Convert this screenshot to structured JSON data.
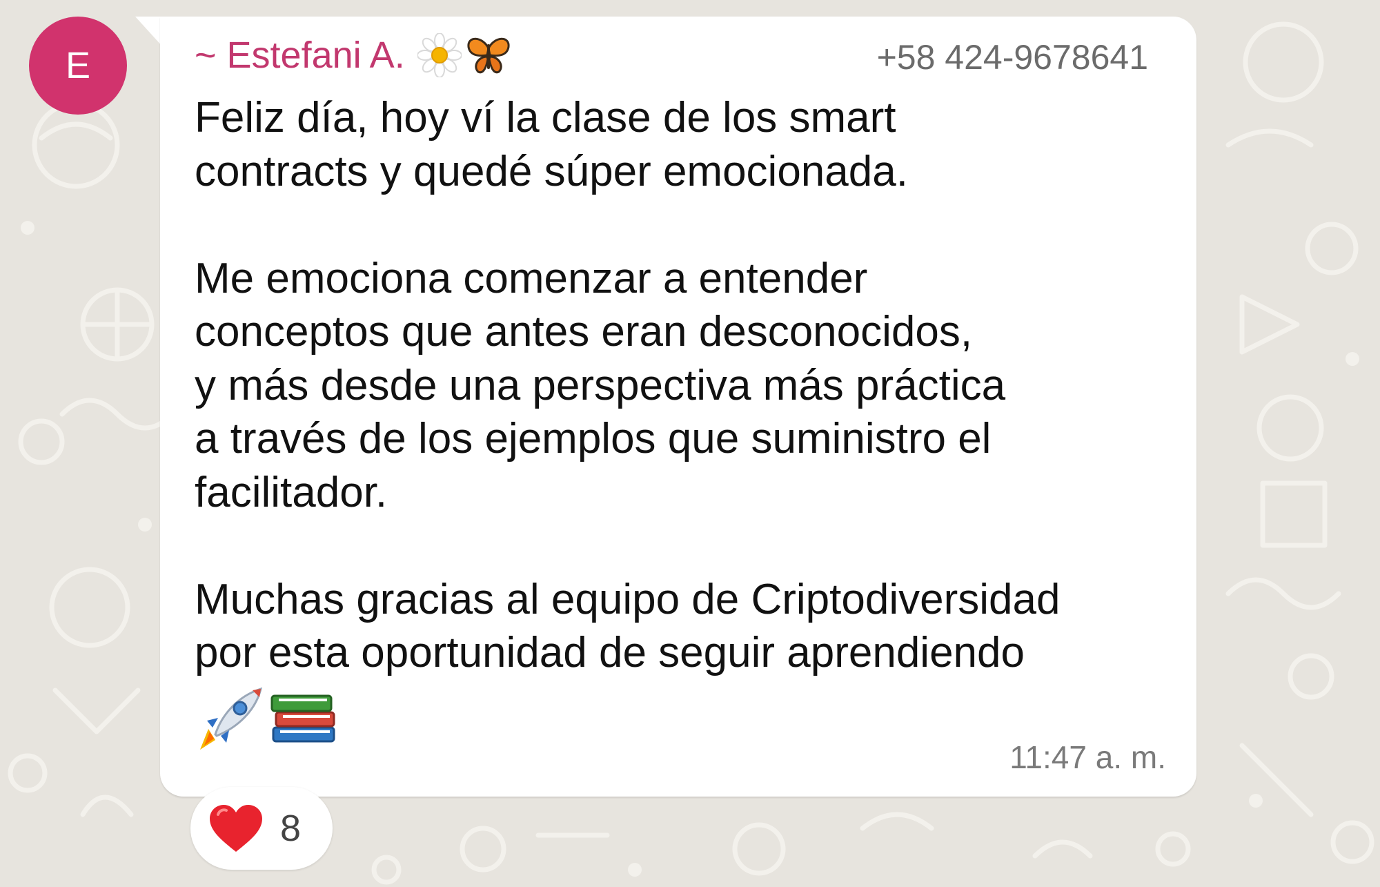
{
  "avatar": {
    "initial": "E",
    "color": "#d1336d"
  },
  "message": {
    "sender_name": "~ Estefani A.",
    "sender_emojis": [
      "daisy-icon",
      "butterfly-icon"
    ],
    "sender_color": "#c2386e",
    "phone": "+58 424-9678641",
    "text": "Feliz día, hoy ví la clase de los smart\ncontracts y quedé súper emocionada.\n\nMe emociona comenzar a entender\nconceptos que antes eran desconocidos,\ny más desde una perspectiva más práctica\na través de los ejemplos que suministro el\nfacilitador.\n\nMuchas gracias al equipo de Criptodiversidad\npor esta oportunidad de seguir aprendiendo",
    "trailing_emojis": [
      "rocket-icon",
      "books-icon"
    ],
    "timestamp": "11:47 a. m."
  },
  "reaction": {
    "emoji": "heart-icon",
    "count": "8"
  }
}
